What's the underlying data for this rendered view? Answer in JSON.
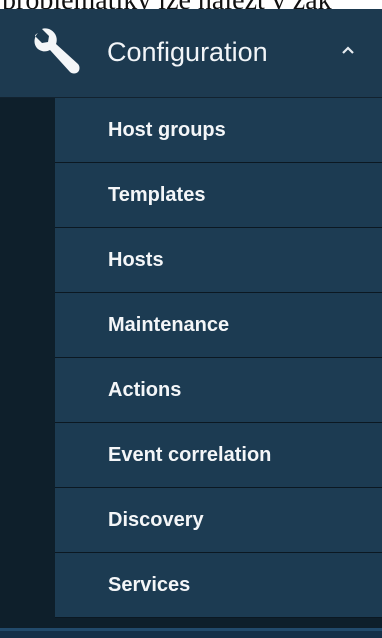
{
  "document_fragment": "problematiky lze nalezt v zak",
  "sidebar": {
    "section": {
      "label": "Configuration",
      "icon": "wrench-icon",
      "expanded_indicator": "chevron-up-icon"
    },
    "items": [
      {
        "label": "Host groups"
      },
      {
        "label": "Templates"
      },
      {
        "label": "Hosts"
      },
      {
        "label": "Maintenance"
      },
      {
        "label": "Actions"
      },
      {
        "label": "Event correlation"
      },
      {
        "label": "Discovery"
      },
      {
        "label": "Services"
      }
    ]
  },
  "colors": {
    "header_bg": "#1d3a50",
    "item_bg": "#1c3b52",
    "indent_bg": "#0e1f2b",
    "text": "#f2f5f8"
  }
}
